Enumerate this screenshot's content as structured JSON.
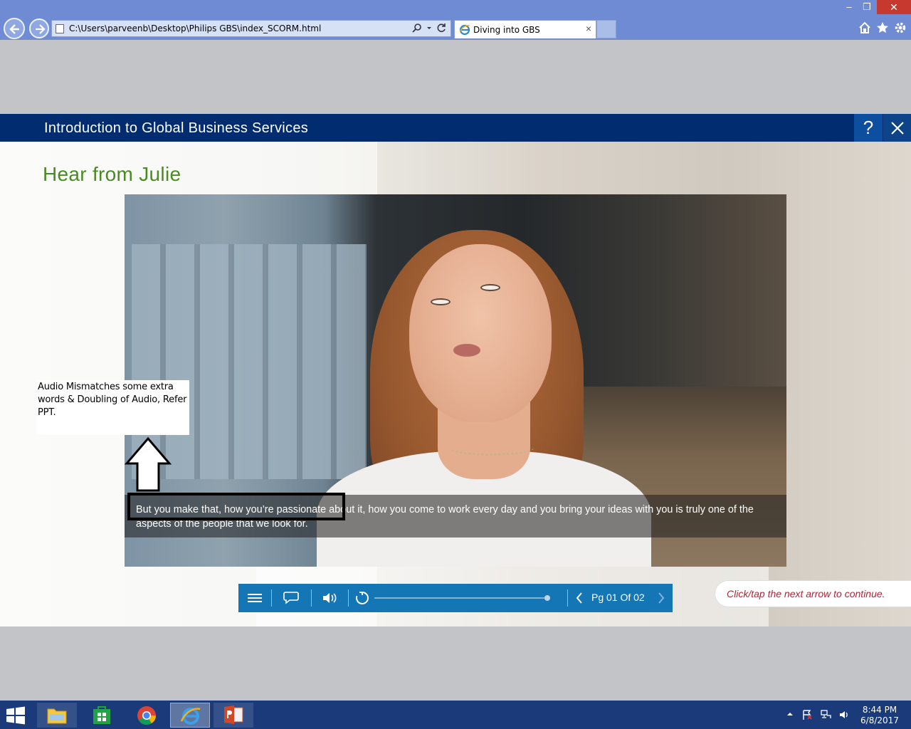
{
  "browser": {
    "address": "C:\\Users\\parveenb\\Desktop\\Philips GBS\\index_SCORM.html",
    "tab_title": "Diving into GBS",
    "tab_close": "×",
    "window_controls": {
      "minimize": "–",
      "restore": "❐",
      "close": "✕"
    }
  },
  "course": {
    "title": "Introduction to Global Business Services",
    "help_label": "?"
  },
  "slide": {
    "title": "Hear from Julie",
    "caption": "But you make that, how you’re passionate about it, how you come to work every day and you bring your ideas with you is truly one of the aspects of the people that we look for.",
    "hint": "Click/tap the next arrow to continue."
  },
  "player": {
    "page_counter": "Pg 01 Of 02",
    "progress": 0.99
  },
  "annotation": {
    "note": "Audio Mismatches some extra words & Doubling of Audio, Refer PPT."
  },
  "taskbar": {
    "time": "8:44 PM",
    "date": "6/8/2017"
  },
  "colors": {
    "header_navy": "#012d70",
    "player_blue": "#1476b5",
    "title_green": "#4a8a24",
    "hint_red": "#a8283c"
  }
}
